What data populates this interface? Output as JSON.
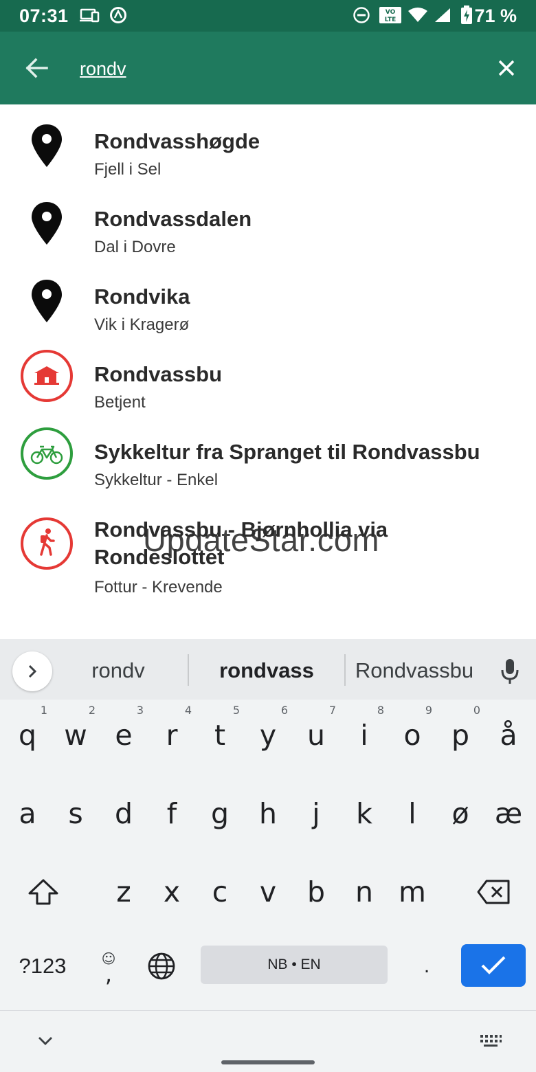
{
  "status_bar": {
    "time": "07:31",
    "volte_label": "VO LTE",
    "battery_percent": "71 %",
    "icons": [
      "cast-icon",
      "data-saver-icon",
      "dnd-icon",
      "volte-icon",
      "wifi-icon",
      "signal-icon",
      "battery-charging-icon"
    ]
  },
  "app_bar": {
    "search_value": "rondv",
    "back_icon": "arrow-back-icon",
    "clear_icon": "close-icon",
    "color": "#1f7a5e"
  },
  "results": [
    {
      "title": "Rondvasshøgde",
      "subtitle": "Fjell i Sel",
      "icon": "map-pin-icon"
    },
    {
      "title": "Rondvassdalen",
      "subtitle": "Dal i Dovre",
      "icon": "map-pin-icon"
    },
    {
      "title": "Rondvika",
      "subtitle": "Vik i Kragerø",
      "icon": "map-pin-icon"
    },
    {
      "title": "Rondvassbu",
      "subtitle": "Betjent",
      "icon": "cabin-icon",
      "color": "#e53935"
    },
    {
      "title": "Sykkeltur fra Spranget til Rondvassbu",
      "subtitle": "Sykkeltur - Enkel",
      "icon": "bicycle-icon",
      "color": "#2e9e3e"
    },
    {
      "title_line1": "Rondvassbu - Bjørnhollia via",
      "title_line2": "Rondeslottet",
      "subtitle": "Fottur - Krevende",
      "icon": "hiker-icon",
      "color": "#e53935"
    }
  ],
  "watermark": "UpdateStar.com",
  "keyboard": {
    "suggestions": [
      "rondv",
      "rondvass",
      "Rondvassbu"
    ],
    "row1": [
      {
        "k": "q",
        "h": "1"
      },
      {
        "k": "w",
        "h": "2"
      },
      {
        "k": "e",
        "h": "3"
      },
      {
        "k": "r",
        "h": "4"
      },
      {
        "k": "t",
        "h": "5"
      },
      {
        "k": "y",
        "h": "6"
      },
      {
        "k": "u",
        "h": "7"
      },
      {
        "k": "i",
        "h": "8"
      },
      {
        "k": "o",
        "h": "9"
      },
      {
        "k": "p",
        "h": "0"
      },
      {
        "k": "å",
        "h": ""
      }
    ],
    "row2": [
      "a",
      "s",
      "d",
      "f",
      "g",
      "h",
      "j",
      "k",
      "l",
      "ø",
      "æ"
    ],
    "row3": [
      "z",
      "x",
      "c",
      "v",
      "b",
      "n",
      "m"
    ],
    "symbols_label": "?123",
    "comma_label": ",",
    "emoji_label": "☺",
    "space_label": "NB • EN",
    "period_label": ".",
    "accent_color": "#1a73e8"
  }
}
